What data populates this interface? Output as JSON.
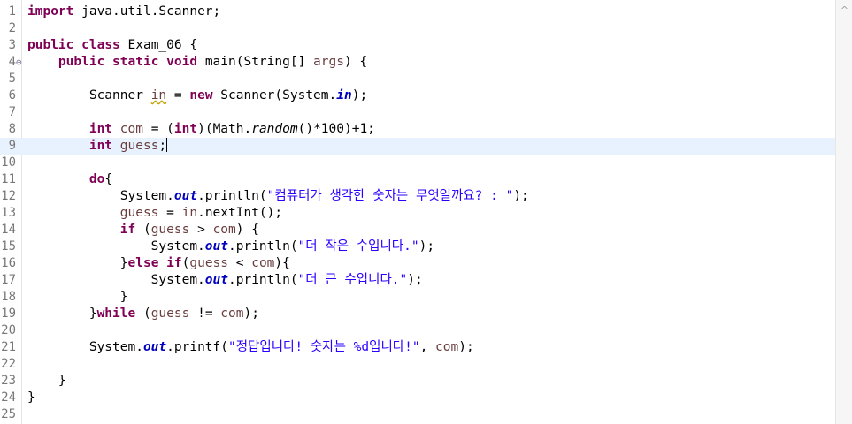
{
  "editor": {
    "language": "java",
    "current_line": 9,
    "lines": [
      {
        "n": "1",
        "tokens": [
          [
            "kw",
            "import"
          ],
          [
            "t",
            " java.util.Scanner;"
          ]
        ]
      },
      {
        "n": "2",
        "tokens": []
      },
      {
        "n": "3",
        "tokens": [
          [
            "kw",
            "public"
          ],
          [
            "t",
            " "
          ],
          [
            "kw",
            "class"
          ],
          [
            "t",
            " Exam_06 {"
          ]
        ]
      },
      {
        "n": "4",
        "fold": "⊖",
        "tokens": [
          [
            "t",
            "    "
          ],
          [
            "kw",
            "public"
          ],
          [
            "t",
            " "
          ],
          [
            "kw",
            "static"
          ],
          [
            "t",
            " "
          ],
          [
            "kw",
            "void"
          ],
          [
            "t",
            " main(String[] "
          ],
          [
            "var",
            "args"
          ],
          [
            "t",
            ") {"
          ]
        ]
      },
      {
        "n": "5",
        "tokens": []
      },
      {
        "n": "6",
        "tokens": [
          [
            "t",
            "        Scanner "
          ],
          [
            "varw",
            "in"
          ],
          [
            "t",
            " = "
          ],
          [
            "kw",
            "new"
          ],
          [
            "t",
            " Scanner(System."
          ],
          [
            "fld",
            "in"
          ],
          [
            "t",
            ");"
          ]
        ]
      },
      {
        "n": "7",
        "tokens": []
      },
      {
        "n": "8",
        "tokens": [
          [
            "t",
            "        "
          ],
          [
            "kw",
            "int"
          ],
          [
            "t",
            " "
          ],
          [
            "var",
            "com"
          ],
          [
            "t",
            " = ("
          ],
          [
            "kw",
            "int"
          ],
          [
            "t",
            ")(Math."
          ],
          [
            "it",
            "random"
          ],
          [
            "t",
            "()*100)+1;"
          ]
        ]
      },
      {
        "n": "9",
        "tokens": [
          [
            "t",
            "        "
          ],
          [
            "kw",
            "int"
          ],
          [
            "t",
            " "
          ],
          [
            "var",
            "guess"
          ],
          [
            "t",
            ";"
          ],
          [
            "caret",
            ""
          ]
        ]
      },
      {
        "n": "10",
        "tokens": []
      },
      {
        "n": "11",
        "tokens": [
          [
            "t",
            "        "
          ],
          [
            "kw",
            "do"
          ],
          [
            "t",
            "{"
          ]
        ]
      },
      {
        "n": "12",
        "tokens": [
          [
            "t",
            "            System."
          ],
          [
            "fld",
            "out"
          ],
          [
            "t",
            ".println("
          ],
          [
            "str",
            "\"컴퓨터가 생각한 숫자는 무엇일까요? : \""
          ],
          [
            "t",
            ");"
          ]
        ]
      },
      {
        "n": "13",
        "tokens": [
          [
            "t",
            "            "
          ],
          [
            "var",
            "guess"
          ],
          [
            "t",
            " = "
          ],
          [
            "var",
            "in"
          ],
          [
            "t",
            ".nextInt();"
          ]
        ]
      },
      {
        "n": "14",
        "tokens": [
          [
            "t",
            "            "
          ],
          [
            "kw",
            "if"
          ],
          [
            "t",
            " ("
          ],
          [
            "var",
            "guess"
          ],
          [
            "t",
            " > "
          ],
          [
            "var",
            "com"
          ],
          [
            "t",
            ") {"
          ]
        ]
      },
      {
        "n": "15",
        "tokens": [
          [
            "t",
            "                System."
          ],
          [
            "fld",
            "out"
          ],
          [
            "t",
            ".println("
          ],
          [
            "str",
            "\"더 작은 수입니다.\""
          ],
          [
            "t",
            ");"
          ]
        ]
      },
      {
        "n": "16",
        "tokens": [
          [
            "t",
            "            }"
          ],
          [
            "kw",
            "else"
          ],
          [
            "t",
            " "
          ],
          [
            "kw",
            "if"
          ],
          [
            "t",
            "("
          ],
          [
            "var",
            "guess"
          ],
          [
            "t",
            " < "
          ],
          [
            "var",
            "com"
          ],
          [
            "t",
            "){"
          ]
        ]
      },
      {
        "n": "17",
        "tokens": [
          [
            "t",
            "                System."
          ],
          [
            "fld",
            "out"
          ],
          [
            "t",
            ".println("
          ],
          [
            "str",
            "\"더 큰 수입니다.\""
          ],
          [
            "t",
            ");"
          ]
        ]
      },
      {
        "n": "18",
        "tokens": [
          [
            "t",
            "            }"
          ]
        ]
      },
      {
        "n": "19",
        "tokens": [
          [
            "t",
            "        }"
          ],
          [
            "kw",
            "while"
          ],
          [
            "t",
            " ("
          ],
          [
            "var",
            "guess"
          ],
          [
            "t",
            " != "
          ],
          [
            "var",
            "com"
          ],
          [
            "t",
            ");"
          ]
        ]
      },
      {
        "n": "20",
        "tokens": []
      },
      {
        "n": "21",
        "tokens": [
          [
            "t",
            "        System."
          ],
          [
            "fld",
            "out"
          ],
          [
            "t",
            ".printf("
          ],
          [
            "str",
            "\"정답입니다! 숫자는 %d입니다!\""
          ],
          [
            "t",
            ", "
          ],
          [
            "var",
            "com"
          ],
          [
            "t",
            ");"
          ]
        ]
      },
      {
        "n": "22",
        "tokens": []
      },
      {
        "n": "23",
        "tokens": [
          [
            "t",
            "    }"
          ]
        ]
      },
      {
        "n": "24",
        "tokens": [
          [
            "t",
            "}"
          ]
        ]
      },
      {
        "n": "25",
        "tokens": []
      }
    ]
  },
  "scrollbar": {
    "up_icon": "chevron-up-icon",
    "up_glyph": "^"
  },
  "colors": {
    "keyword": "#7f0055",
    "local_variable": "#6a3e3e",
    "static_field": "#0000c0",
    "string": "#2a00ff",
    "current_line": "#e8f2fe",
    "line_number": "#787878"
  }
}
